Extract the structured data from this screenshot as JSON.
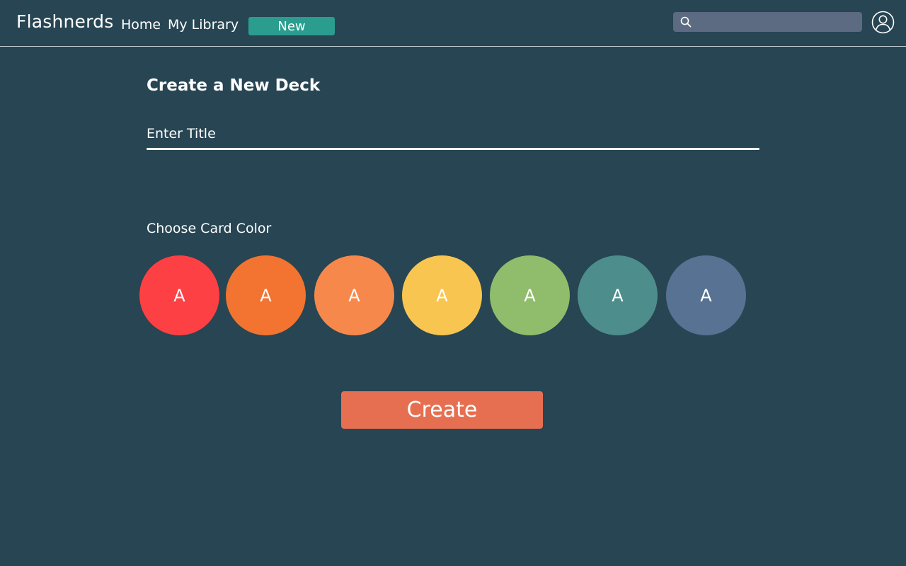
{
  "header": {
    "brand": "Flashnerds",
    "nav": {
      "home": "Home",
      "library": "My Library",
      "new": "New"
    },
    "search": {
      "placeholder": "",
      "icon": "search-icon"
    },
    "avatar_icon": "user-circle-icon"
  },
  "main": {
    "title": "Create a New Deck",
    "title_input": {
      "placeholder": "Enter Title",
      "value": ""
    },
    "color_label": "Choose Card Color",
    "swatches": [
      {
        "letter": "A",
        "color": "#fd4044"
      },
      {
        "letter": "A",
        "color": "#f27430"
      },
      {
        "letter": "A",
        "color": "#f7884b"
      },
      {
        "letter": "A",
        "color": "#f8c650"
      },
      {
        "letter": "A",
        "color": "#8fbd6c"
      },
      {
        "letter": "A",
        "color": "#4d8d8c"
      },
      {
        "letter": "A",
        "color": "#577292"
      }
    ],
    "create_label": "Create"
  },
  "colors": {
    "background": "#274553",
    "accent_new": "#2a9d8f",
    "create_button": "#e76f51",
    "search_bg": "#5c6b81"
  }
}
